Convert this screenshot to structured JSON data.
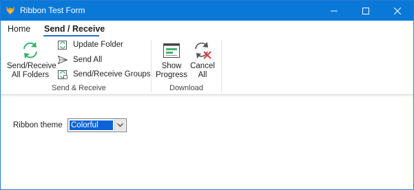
{
  "window": {
    "title": "Ribbon Test Form",
    "titlebar_color": "#0a78d7",
    "controls": [
      "minimize-icon",
      "maximize-icon",
      "close-icon"
    ]
  },
  "tabs": [
    {
      "label": "Home",
      "active": false
    },
    {
      "label": "Send / Receive",
      "active": true
    }
  ],
  "ribbon": {
    "groups": [
      {
        "label": "Send & Receive",
        "large_buttons": [
          {
            "label_line1": "Send/Receive",
            "label_line2": "All Folders",
            "icon": "sync-icon"
          }
        ],
        "small_buttons": [
          {
            "label": "Update Folder",
            "icon": "update-folder-icon"
          },
          {
            "label": "Send All",
            "icon": "send-icon"
          },
          {
            "label": "Send/Receive Groups",
            "icon": "groups-icon"
          }
        ]
      },
      {
        "label": "Download",
        "large_buttons": [
          {
            "label_line1": "Show",
            "label_line2": "Progress",
            "icon": "progress-window-icon"
          },
          {
            "label_line1": "Cancel",
            "label_line2": "All",
            "icon": "cancel-sync-icon"
          }
        ]
      }
    ]
  },
  "form": {
    "theme_label": "Ribbon theme",
    "theme_value": "Colorful"
  },
  "colors": {
    "accent": "#0a78d7",
    "tab_underline": "#2b6fc9",
    "selection": "#0a64d8",
    "sync_green": "#3cb371",
    "cancel_red": "#e23b3b"
  }
}
